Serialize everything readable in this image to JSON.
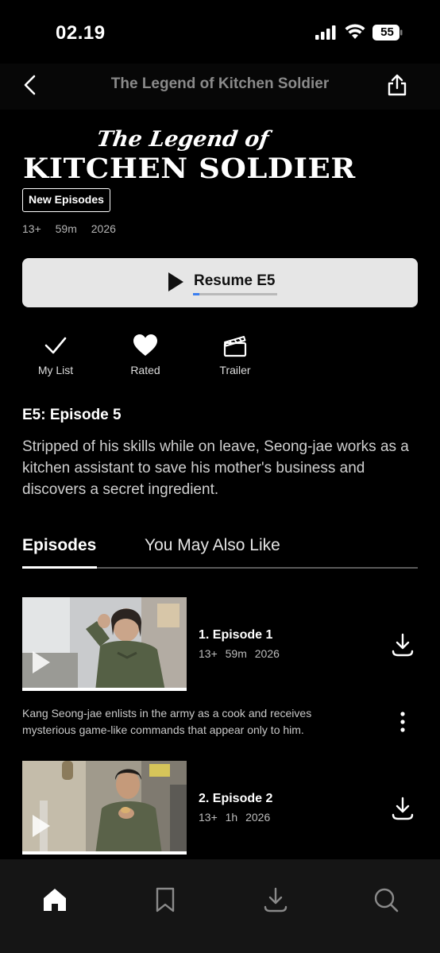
{
  "status_bar": {
    "time": "02.19",
    "battery": "55"
  },
  "header": {
    "title": "The Legend of Kitchen Soldier"
  },
  "show": {
    "logo_top": "The Legend of",
    "logo_main": "KITCHEN SOLDIER",
    "badge": "New Episodes",
    "rating": "13+",
    "duration": "59m",
    "year": "2026"
  },
  "resume": {
    "label": "Resume E5",
    "progress": 0.08
  },
  "actions": [
    {
      "label": "My List",
      "icon": "check-icon"
    },
    {
      "label": "Rated",
      "icon": "heart-icon"
    },
    {
      "label": "Trailer",
      "icon": "clapperboard-icon"
    }
  ],
  "current_episode": {
    "title": "E5: Episode 5",
    "description": "Stripped of his skills while on leave, Seong-jae works as a kitchen assistant to save his mother's business and discovers a secret ingredient."
  },
  "tabs": [
    {
      "label": "Episodes",
      "active": true
    },
    {
      "label": "You May Also Like",
      "active": false
    }
  ],
  "episodes": [
    {
      "name": "1. Episode 1",
      "rating": "13+",
      "duration": "59m",
      "year": "2026",
      "synopsis": "Kang Seong-jae enlists in the army as a cook and receives mysterious game-like commands that appear only to him."
    },
    {
      "name": "2. Episode 2",
      "rating": "13+",
      "duration": "1h",
      "year": "2026"
    }
  ],
  "tabbar": [
    "home-icon",
    "bookmark-icon",
    "download-icon",
    "search-icon"
  ],
  "colors": {
    "background": "#000000",
    "accent_progress": "#3b7ff0",
    "button": "#e6e6e6",
    "tabbar": "#151515"
  }
}
